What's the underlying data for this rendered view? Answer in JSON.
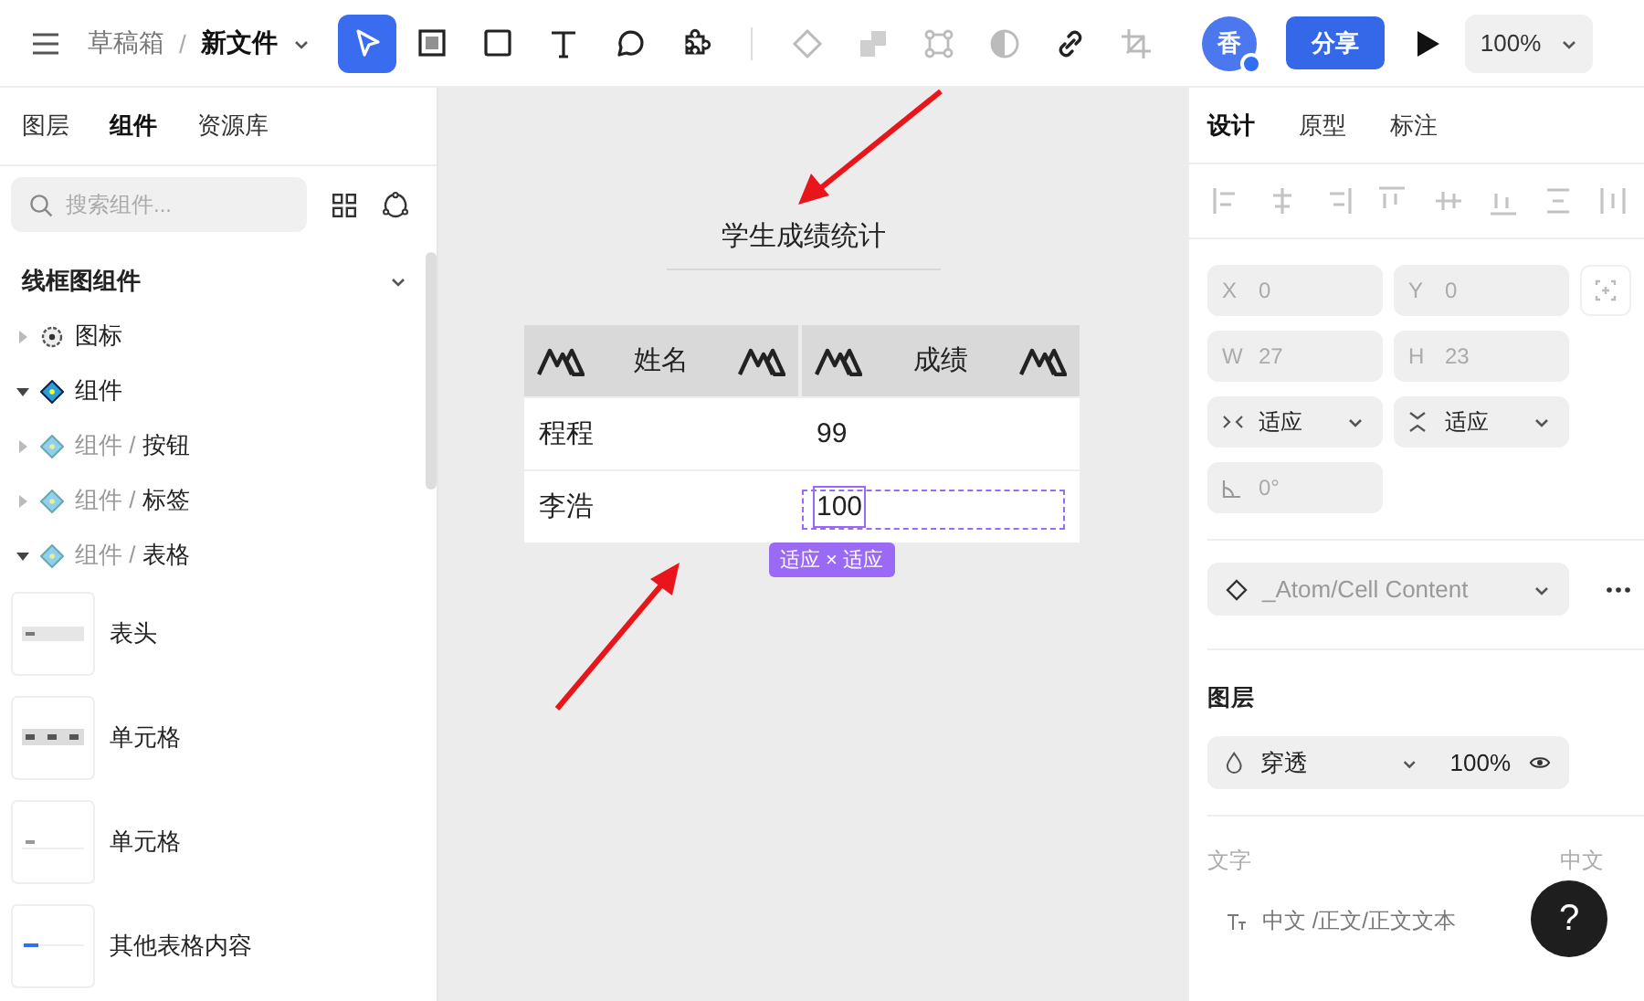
{
  "topbar": {
    "breadcrumb": {
      "parent": "草稿箱",
      "separator": "/",
      "file": "新文件"
    },
    "tools": [
      {
        "kind": "pointer",
        "selected": true,
        "disabled": false
      },
      {
        "kind": "frame",
        "selected": false,
        "disabled": false
      },
      {
        "kind": "rect",
        "selected": false,
        "disabled": false
      },
      {
        "kind": "text",
        "selected": false,
        "disabled": false
      },
      {
        "kind": "bubble",
        "selected": false,
        "disabled": false
      },
      {
        "kind": "puzzle",
        "selected": false,
        "disabled": false
      },
      {
        "kind": "diamond",
        "selected": false,
        "disabled": true
      },
      {
        "kind": "union",
        "selected": false,
        "disabled": true
      },
      {
        "kind": "bbox",
        "selected": false,
        "disabled": true
      },
      {
        "kind": "halfcircle",
        "selected": false,
        "disabled": true
      },
      {
        "kind": "link",
        "selected": false,
        "disabled": false
      },
      {
        "kind": "crop",
        "selected": false,
        "disabled": true
      }
    ],
    "avatar": "香",
    "share": "分享",
    "zoom": "100%"
  },
  "left_panel": {
    "tabs": [
      {
        "label": "图层",
        "selected": false
      },
      {
        "label": "组件",
        "selected": true
      },
      {
        "label": "资源库",
        "selected": false
      }
    ],
    "search": {
      "placeholder": "搜索组件..."
    },
    "section": {
      "title": "线框图组件",
      "expanded": true
    },
    "tree": [
      {
        "kind": "gear",
        "label": "图标",
        "expanded": false
      },
      {
        "kind": "component",
        "label": "组件",
        "expanded": true
      },
      {
        "kind": "variant",
        "path": "组件 /",
        "label": "按钮",
        "expanded": false
      },
      {
        "kind": "variant",
        "path": "组件 /",
        "label": "标签",
        "expanded": false
      },
      {
        "kind": "variant",
        "path": "组件 /",
        "label": "表格",
        "expanded": true
      }
    ],
    "components": [
      {
        "kind": "header",
        "label": "表头"
      },
      {
        "kind": "icons",
        "label": "单元格"
      },
      {
        "kind": "plain",
        "label": "单元格"
      },
      {
        "kind": "line",
        "label": "其他表格内容"
      }
    ]
  },
  "canvas": {
    "title": "学生成绩统计",
    "table": {
      "columns": [
        "姓名",
        "成绩"
      ],
      "rows": [
        [
          {
            "text": "程程",
            "selected": false
          },
          {
            "text": "99",
            "selected": false
          }
        ],
        [
          {
            "text": "李浩",
            "selected": false
          },
          {
            "text": "100",
            "selected": true
          }
        ]
      ]
    },
    "selection": {
      "badge": "适应 × 适应"
    }
  },
  "right_panel": {
    "tabs": [
      {
        "label": "设计",
        "selected": true
      },
      {
        "label": "原型",
        "selected": false
      },
      {
        "label": "标注",
        "selected": false
      }
    ],
    "fields": [
      {
        "kind": "letter",
        "prefix": "X",
        "value": "0",
        "disabled": true
      },
      {
        "kind": "letter",
        "prefix": "Y",
        "value": "0",
        "disabled": true
      },
      {
        "kind": "letter",
        "prefix": "W",
        "value": "27",
        "disabled": true
      },
      {
        "kind": "letter",
        "prefix": "H",
        "value": "23",
        "disabled": true
      },
      {
        "kind": "hresize",
        "value": "适应",
        "disabled": false
      },
      {
        "kind": "vresize",
        "value": "适应",
        "disabled": false
      },
      {
        "kind": "rotation",
        "value": "0°",
        "disabled": true
      }
    ],
    "component": "_Atom/Cell Content",
    "layer": {
      "title": "图层",
      "blend": "穿透",
      "opacity": "100%"
    },
    "text": {
      "title": "文字",
      "language": "中文",
      "style": "中文 /正文/正文文本"
    },
    "help": "?"
  }
}
